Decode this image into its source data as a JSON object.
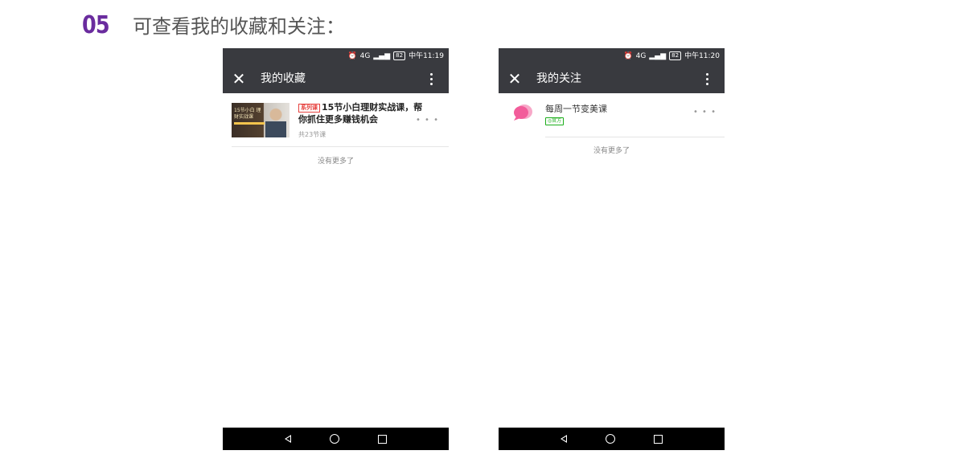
{
  "header": {
    "step_number": "05",
    "title": "可查看我的收藏和关注："
  },
  "left_phone": {
    "status_bar": {
      "battery": "82",
      "time": "中午11:19",
      "signal": "4G"
    },
    "title": "我的收藏",
    "items": [
      {
        "tag": "系列课",
        "title": "15节小白理财实战课，帮你抓住更多赚钱机会",
        "subtitle": "共23节课",
        "thumb_text": "15节小白 理财实战课"
      }
    ],
    "footer_text": "没有更多了"
  },
  "right_phone": {
    "status_bar": {
      "battery": "82",
      "time": "中午11:20",
      "signal": "4G"
    },
    "title": "我的关注",
    "items": [
      {
        "name": "每周一节变美课",
        "badge": "官方"
      }
    ],
    "footer_text": "没有更多了"
  },
  "colors": {
    "step_number": "#6a2c9e",
    "app_bar": "#393a3f",
    "tag_red": "#e64340",
    "official_green": "#1aad19",
    "avatar_pink": "#f25c9a"
  },
  "icons": [
    "close-icon",
    "more-vertical-icon",
    "more-horizontal-icon",
    "alarm-icon",
    "signal-icon",
    "battery-icon",
    "nav-back-icon",
    "nav-home-icon",
    "nav-recent-icon"
  ]
}
